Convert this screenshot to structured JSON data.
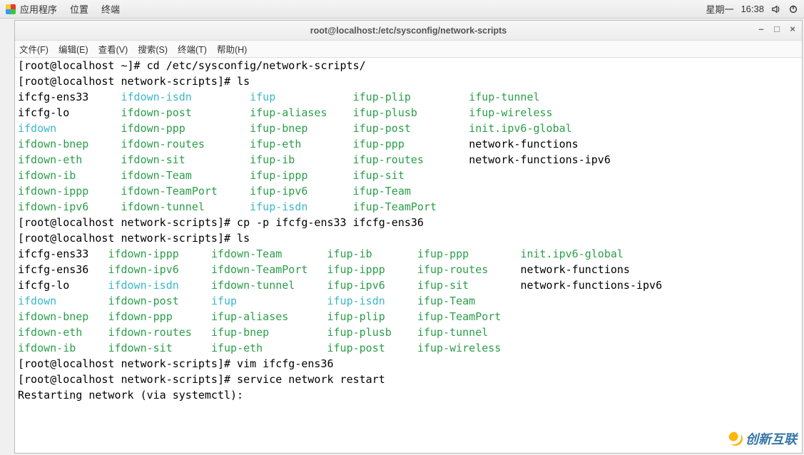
{
  "panel": {
    "applications": "应用程序",
    "places": "位置",
    "terminal": "终端",
    "day": "星期一",
    "time": "16:38"
  },
  "window": {
    "title": "root@localhost:/etc/sysconfig/network-scripts"
  },
  "menubar": {
    "file": "文件(F)",
    "edit": "编辑(E)",
    "view": "查看(V)",
    "search": "搜索(S)",
    "terminal": "终端(T)",
    "help": "帮助(H)"
  },
  "term": {
    "line1": "[root@localhost ~]# cd /etc/sysconfig/network-scripts/",
    "line2": "[root@localhost network-scripts]# ls",
    "ls1": {
      "col1": [
        "ifcfg-ens33",
        "ifcfg-lo",
        "ifdown",
        "ifdown-bnep",
        "ifdown-eth",
        "ifdown-ib",
        "ifdown-ippp",
        "ifdown-ipv6"
      ],
      "col1_class": [
        "k",
        "k",
        "c",
        "g",
        "g",
        "g",
        "g",
        "g"
      ],
      "col2": [
        "ifdown-isdn",
        "ifdown-post",
        "ifdown-ppp",
        "ifdown-routes",
        "ifdown-sit",
        "ifdown-Team",
        "ifdown-TeamPort",
        "ifdown-tunnel"
      ],
      "col2_class": [
        "c",
        "g",
        "g",
        "g",
        "g",
        "g",
        "g",
        "g"
      ],
      "col3": [
        "ifup",
        "ifup-aliases",
        "ifup-bnep",
        "ifup-eth",
        "ifup-ib",
        "ifup-ippp",
        "ifup-ipv6",
        "ifup-isdn"
      ],
      "col3_class": [
        "c",
        "g",
        "g",
        "g",
        "g",
        "g",
        "g",
        "c"
      ],
      "col4": [
        "ifup-plip",
        "ifup-plusb",
        "ifup-post",
        "ifup-ppp",
        "ifup-routes",
        "ifup-sit",
        "ifup-Team",
        "ifup-TeamPort"
      ],
      "col4_class": [
        "g",
        "g",
        "g",
        "g",
        "g",
        "g",
        "g",
        "g"
      ],
      "col5": [
        "ifup-tunnel",
        "ifup-wireless",
        "init.ipv6-global",
        "network-functions",
        "network-functions-ipv6",
        "",
        "",
        ""
      ],
      "col5_class": [
        "g",
        "g",
        "g",
        "k",
        "k",
        "k",
        "k",
        "k"
      ]
    },
    "line3": "[root@localhost network-scripts]# cp -p ifcfg-ens33 ifcfg-ens36",
    "line4": "[root@localhost network-scripts]# ls",
    "ls2": {
      "col1": [
        "ifcfg-ens33",
        "ifcfg-ens36",
        "ifcfg-lo",
        "ifdown",
        "ifdown-bnep",
        "ifdown-eth",
        "ifdown-ib"
      ],
      "col1_class": [
        "k",
        "k",
        "k",
        "c",
        "g",
        "g",
        "g"
      ],
      "col2": [
        "ifdown-ippp",
        "ifdown-ipv6",
        "ifdown-isdn",
        "ifdown-post",
        "ifdown-ppp",
        "ifdown-routes",
        "ifdown-sit"
      ],
      "col2_class": [
        "g",
        "g",
        "c",
        "g",
        "g",
        "g",
        "g"
      ],
      "col3": [
        "ifdown-Team",
        "ifdown-TeamPort",
        "ifdown-tunnel",
        "ifup",
        "ifup-aliases",
        "ifup-bnep",
        "ifup-eth"
      ],
      "col3_class": [
        "g",
        "g",
        "g",
        "c",
        "g",
        "g",
        "g"
      ],
      "col4": [
        "ifup-ib",
        "ifup-ippp",
        "ifup-ipv6",
        "ifup-isdn",
        "ifup-plip",
        "ifup-plusb",
        "ifup-post"
      ],
      "col4_class": [
        "g",
        "g",
        "g",
        "c",
        "g",
        "g",
        "g"
      ],
      "col5": [
        "ifup-ppp",
        "ifup-routes",
        "ifup-sit",
        "ifup-Team",
        "ifup-TeamPort",
        "ifup-tunnel",
        "ifup-wireless"
      ],
      "col5_class": [
        "g",
        "g",
        "g",
        "g",
        "g",
        "g",
        "g"
      ],
      "col6": [
        "init.ipv6-global",
        "network-functions",
        "network-functions-ipv6",
        "",
        "",
        "",
        ""
      ],
      "col6_class": [
        "g",
        "k",
        "k",
        "k",
        "k",
        "k",
        "k"
      ]
    },
    "line5": "[root@localhost network-scripts]# vim ifcfg-ens36",
    "line6": "[root@localhost network-scripts]# service network restart",
    "line7": "Restarting network (via systemctl):"
  },
  "watermark": "创新互联",
  "layout": {
    "ls1_widths": [
      16,
      20,
      16,
      18,
      28
    ],
    "ls2_widths": [
      14,
      16,
      18,
      14,
      16,
      28
    ]
  }
}
